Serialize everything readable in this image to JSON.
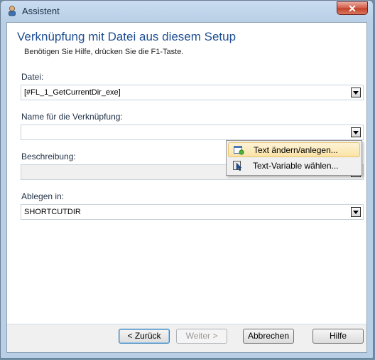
{
  "window": {
    "title": "Assistent",
    "close_label": "✕"
  },
  "header": {
    "title": "Verknüpfung mit Datei aus diesem Setup",
    "subtitle": "Benötigen Sie Hilfe, drücken Sie die F1-Taste."
  },
  "fields": {
    "datei": {
      "label": "Datei:",
      "value": "[#FL_1_GetCurrentDir_exe]"
    },
    "name": {
      "label": "Name für die Verknüpfung:",
      "value": ""
    },
    "beschreibung": {
      "label": "Beschreibung:",
      "value": ""
    },
    "ablegen": {
      "label": "Ablegen in:",
      "value": "SHORTCUTDIR"
    }
  },
  "context_menu": {
    "items": [
      {
        "label": "Text ändern/anlegen...",
        "icon": "edit-text-icon"
      },
      {
        "label": "Text-Variable wählen...",
        "icon": "select-variable-icon"
      }
    ]
  },
  "buttons": {
    "back": "< Zurück",
    "next": "Weiter >",
    "cancel": "Abbrechen",
    "help": "Hilfe"
  }
}
